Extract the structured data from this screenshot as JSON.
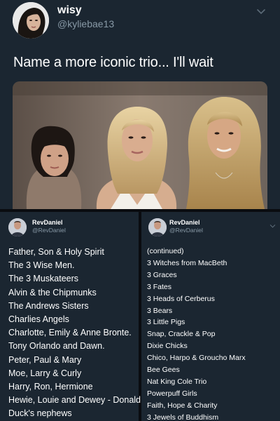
{
  "top_tweet": {
    "display_name": "wisy",
    "handle": "@kyliebae13",
    "text": "Name a more iconic trio... I'll wait"
  },
  "reply_left": {
    "display_name": "RevDaniel",
    "handle": "@RevDaniel",
    "items": [
      "Father, Son & Holy Spirit",
      "The 3 Wise Men.",
      "The 3 Muskateers",
      "Alvin & the Chipmunks",
      "The Andrews Sisters",
      "Charlies Angels",
      "Charlotte, Emily & Anne Bronte.",
      "Tony Orlando and Dawn.",
      "Peter, Paul & Mary",
      "Moe, Larry & Curly",
      "Harry, Ron, Hermione",
      "Hewie, Louie and Dewey - Donald",
      "Duck's nephews"
    ]
  },
  "reply_right": {
    "display_name": "RevDaniel",
    "handle": "@RevDaniel",
    "items": [
      "(continued)",
      "3 Witches from MacBeth",
      "3 Graces",
      "3 Fates",
      "3 Heads of Cerberus",
      "3 Bears",
      "3 Little Pigs",
      "Snap, Crackle & Pop",
      "Dixie Chicks",
      "Chico, Harpo & Groucho Marx",
      "Bee Gees",
      "Nat King Cole Trio",
      "Powerpuff Girls",
      "Faith, Hope & Charity",
      "3 Jewels of Buddhism"
    ]
  },
  "icons": {
    "menu": "chevron-down-icon",
    "avatar": "avatar"
  },
  "colors": {
    "card_bg": "#1b2631",
    "secondary_text": "#8899a6",
    "divider": "#0a0c10"
  }
}
